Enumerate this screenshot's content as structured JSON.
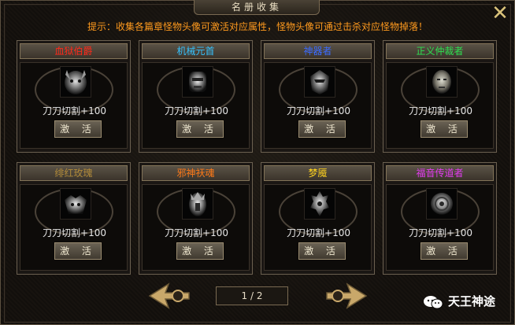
{
  "window": {
    "title": "名册收集"
  },
  "hint": "提示：收集各篇章怪物头像可激活对应属性，怪物头像可通过击杀对应怪物掉落！",
  "cards": [
    {
      "name": "血狱伯爵",
      "color": "#ff2a1a",
      "attr": "刀刀切割+100",
      "button": "激 活",
      "portrait": "demon-head-icon"
    },
    {
      "name": "机械元首",
      "color": "#35c3ff",
      "attr": "刀刀切割+100",
      "button": "激 活",
      "portrait": "mech-head-icon"
    },
    {
      "name": "神器者",
      "color": "#3b6bff",
      "attr": "刀刀切割+100",
      "button": "激 活",
      "portrait": "armored-head-icon"
    },
    {
      "name": "正义仲裁者",
      "color": "#2ee050",
      "attr": "刀刀切割+100",
      "button": "激 活",
      "portrait": "stone-face-icon"
    },
    {
      "name": "绯红玫瑰",
      "color": "#b08a3a",
      "attr": "刀刀切割+100",
      "button": "激 活",
      "portrait": "rose-head-icon"
    },
    {
      "name": "邪神祆魂",
      "color": "#ff7a18",
      "attr": "刀刀切割+100",
      "button": "激 活",
      "portrait": "evil-god-icon"
    },
    {
      "name": "梦魇",
      "color": "#ffd21e",
      "attr": "刀刀切割+100",
      "button": "激 活",
      "portrait": "nightmare-icon"
    },
    {
      "name": "福音传道者",
      "color": "#e23cf0",
      "attr": "刀刀切割+100",
      "button": "激 活",
      "portrait": "evangelist-icon"
    }
  ],
  "pager": {
    "text": "1 / 2"
  },
  "watermark": {
    "text": "天王神途"
  }
}
